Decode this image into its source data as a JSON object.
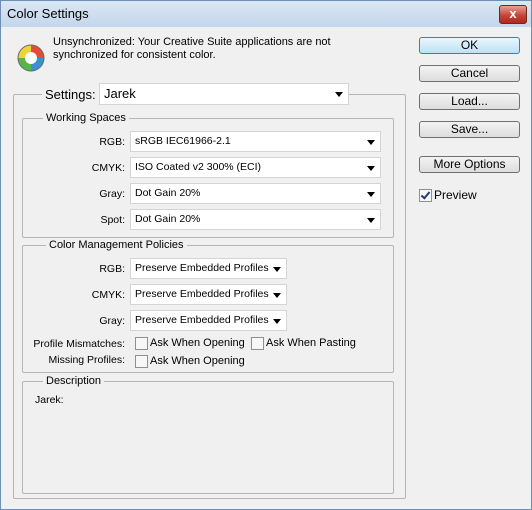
{
  "window": {
    "title": "Color Settings",
    "close_glyph": "x"
  },
  "info": {
    "icon": "color-wheel-icon",
    "line1": "Unsynchronized: Your Creative Suite applications are not",
    "line2": "synchronized for consistent color."
  },
  "settings": {
    "label": "Settings:",
    "value": "Jarek"
  },
  "working_spaces": {
    "title": "Working Spaces",
    "rgb": {
      "label": "RGB:",
      "value": "sRGB IEC61966-2.1"
    },
    "cmyk": {
      "label": "CMYK:",
      "value": "ISO Coated v2 300% (ECI)"
    },
    "gray": {
      "label": "Gray:",
      "value": "Dot Gain 20%"
    },
    "spot": {
      "label": "Spot:",
      "value": "Dot Gain 20%"
    }
  },
  "policies": {
    "title": "Color Management Policies",
    "rgb": {
      "label": "RGB:",
      "value": "Preserve Embedded Profiles"
    },
    "cmyk": {
      "label": "CMYK:",
      "value": "Preserve Embedded Profiles"
    },
    "gray": {
      "label": "Gray:",
      "value": "Preserve Embedded Profiles"
    },
    "mismatch_label": "Profile Mismatches:",
    "ask_opening": "Ask When Opening",
    "ask_pasting": "Ask When Pasting",
    "missing_label": "Missing Profiles:",
    "missing_ask_opening": "Ask When Opening"
  },
  "description": {
    "title": "Description",
    "text": "Jarek:"
  },
  "buttons": {
    "ok": "OK",
    "cancel": "Cancel",
    "load": "Load...",
    "save": "Save...",
    "more": "More Options"
  },
  "preview": {
    "label": "Preview",
    "checked": true
  }
}
